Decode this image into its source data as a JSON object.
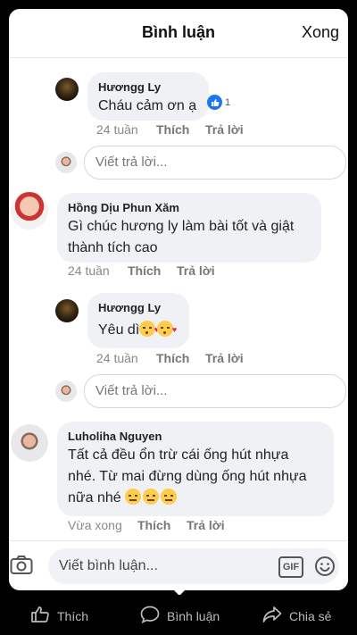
{
  "header": {
    "title": "Bình luận",
    "done_label": "Xong"
  },
  "comments": [
    {
      "name": "Hươngg Ly",
      "text": "Cháu cảm ơn ạ",
      "time": "24 tuần",
      "like_label": "Thích",
      "reply_label": "Trả lời",
      "like_count": "1"
    },
    {
      "name": "Hồng Dịu Phun Xăm",
      "text_line1": "Gì chúc hương ly làm bài tốt và giật",
      "text_line2": "thành tích cao",
      "time": "24 tuần",
      "like_label": "Thích",
      "reply_label": "Trả lời"
    },
    {
      "name": "Hươngg Ly",
      "text": "Yêu dì",
      "time": "24 tuần",
      "like_label": "Thích",
      "reply_label": "Trả lời"
    },
    {
      "name": "Luholiha Nguyen",
      "text_line1": "Tất cả đều ổn trừ cái ống hút nhựa",
      "text_line2": "nhé. Từ mai đừng dùng ống hút nhựa",
      "text_line3": "nữa nhé",
      "time": "Vừa xong",
      "like_label": "Thích",
      "reply_label": "Trả lời"
    }
  ],
  "reply_placeholder": "Viết trả lời...",
  "composer": {
    "placeholder": "Viết bình luận...",
    "gif_label": "GIF"
  },
  "bottom_bar": {
    "like": "Thích",
    "comment": "Bình luận",
    "share": "Chia sẻ"
  },
  "colors": {
    "accent": "#1877f2",
    "bubble": "#eff1f4",
    "emoji": "#ffcc4d"
  },
  "icons": [
    "thumbs-up-icon",
    "camera-icon",
    "gif-icon",
    "smiley-icon",
    "comment-icon",
    "share-icon"
  ]
}
